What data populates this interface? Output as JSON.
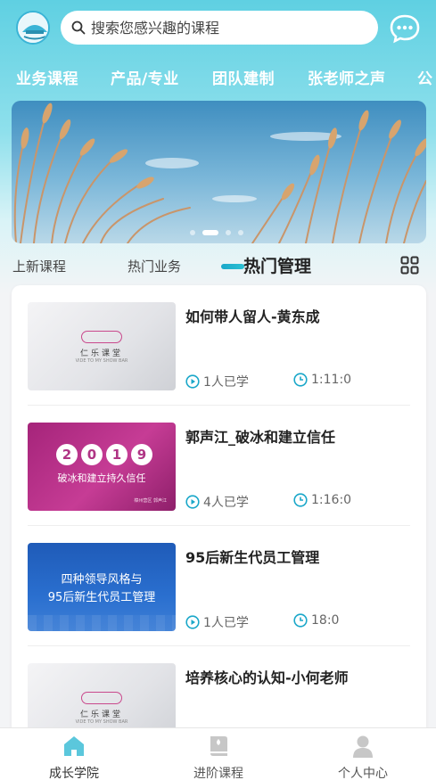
{
  "header": {
    "search_placeholder": "搜索您感兴趣的课程"
  },
  "categories": [
    "业务课程",
    "产品/专业",
    "团队建制",
    "张老师之声",
    "公"
  ],
  "banner": {
    "slides": 4,
    "active_slide": 1
  },
  "tabs": [
    "上新课程",
    "热门业务",
    "热门管理"
  ],
  "active_tab": 2,
  "courses": [
    {
      "title": "如何带人留人-黄东成",
      "learners": "1人已学",
      "duration": "1:11:0",
      "thumb_type": "logo",
      "thumb_logo_text": "仁乐课堂",
      "thumb_sub_text": "VIDE TO MY SHOW BAR"
    },
    {
      "title": "郭声江_破冰和建立信任",
      "learners": "4人已学",
      "duration": "1:16:0",
      "thumb_type": "2019",
      "thumb_year_digits": [
        "2",
        "0",
        "1",
        "9"
      ],
      "thumb_caption": "破冰和建立持久信任",
      "thumb_footer": "樟州营区  郭声江"
    },
    {
      "title": "95后新生代员工管理",
      "learners": "1人已学",
      "duration": "18:0",
      "thumb_type": "blue",
      "thumb_line1": "四种领导风格与",
      "thumb_line2": "95后新生代员工管理"
    },
    {
      "title": "培养核心的认知-小何老师",
      "learners": "",
      "duration": "",
      "thumb_type": "logo",
      "thumb_logo_text": "仁乐课堂",
      "thumb_sub_text": "VIDE TO MY SHOW BAR"
    }
  ],
  "bottom_nav": [
    {
      "label": "成长学院",
      "icon": "home-icon",
      "active": true
    },
    {
      "label": "进阶课程",
      "icon": "book-icon",
      "active": false
    },
    {
      "label": "个人中心",
      "icon": "user-icon",
      "active": false
    }
  ],
  "colors": {
    "accent": "#1aa7c9",
    "active_nav_icon": "#5bc7dc",
    "inactive_nav_icon": "#c7c7c7"
  }
}
